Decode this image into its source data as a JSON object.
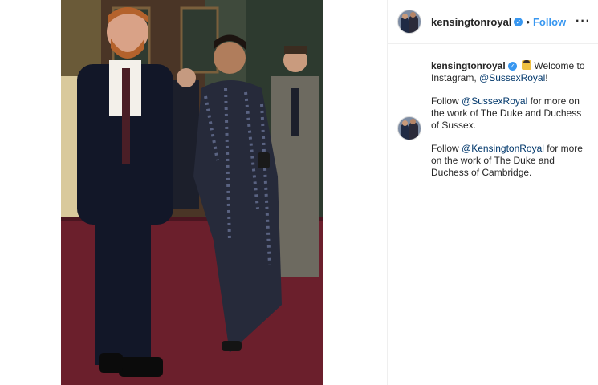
{
  "post": {
    "image_alt": "photo",
    "account": {
      "username": "kensingtonroyal",
      "verified_icon": "verified-badge-icon",
      "dot": "•",
      "follow_label": "Follow",
      "more_label": "···"
    },
    "caption": {
      "username": "kensingtonroyal",
      "p1_text_a": "Welcome to Instagram, ",
      "p1_mention": "@SussexRoyal",
      "p1_text_b": "!",
      "p2_text_a": "Follow ",
      "p2_mention": "@SussexRoyal",
      "p2_text_b": " for more on the work of The Duke and Duchess of Sussex.",
      "p3_text_a": "Follow ",
      "p3_mention": "@KensingtonRoyal",
      "p3_text_b": " for more on the work of The Duke and Duchess of Cambridge."
    }
  },
  "colors": {
    "accent": "#3897f0",
    "mention": "#00376b",
    "carpet": "#5e1f2a"
  }
}
